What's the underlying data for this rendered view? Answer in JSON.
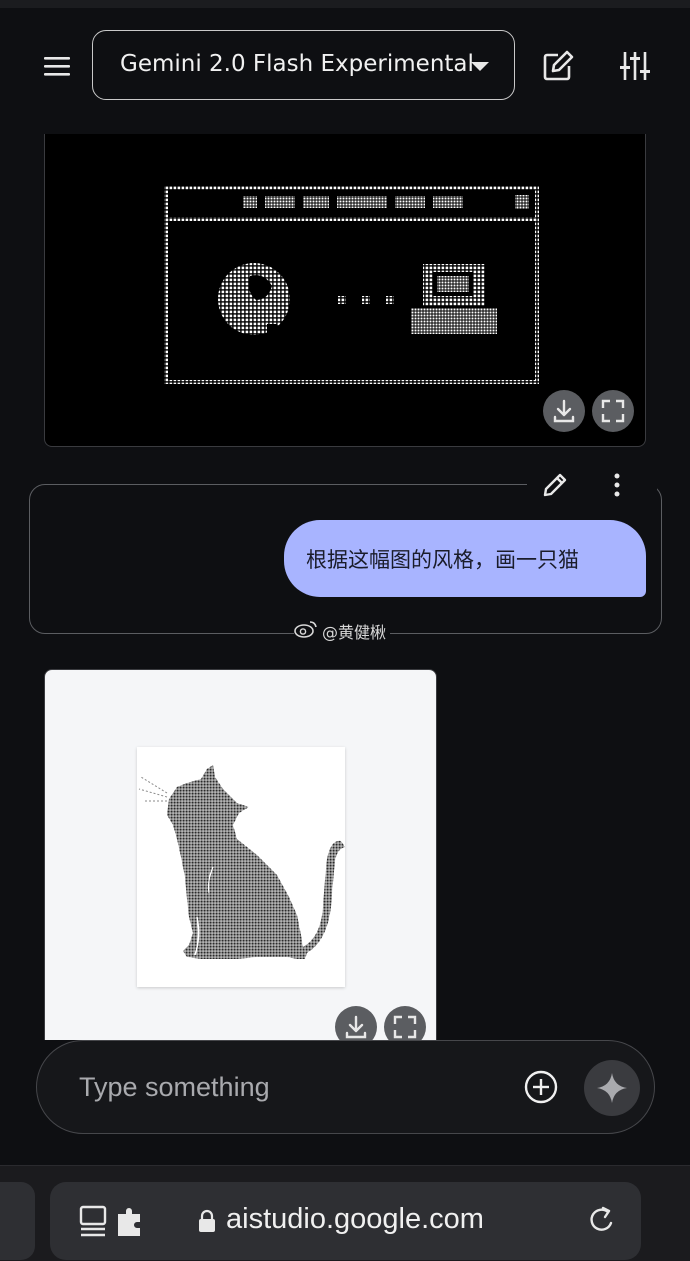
{
  "header": {
    "menu_icon": "hamburger-menu-icon",
    "model_name": "Gemini 2.0 Flash Experimental",
    "new_chat_icon": "edit-square-icon",
    "settings_icon": "tune-sliders-icon"
  },
  "messages": [
    {
      "role": "model",
      "type": "image",
      "description": "pixel-art retro window with globe and computer",
      "actions": [
        "download-icon",
        "fullscreen-icon"
      ]
    },
    {
      "role": "user",
      "text": "根据这幅图的风格，画一只猫",
      "actions": [
        "edit-pencil-icon",
        "more-vert-icon"
      ]
    },
    {
      "role": "model",
      "type": "image",
      "description": "pixel-art dotted cat silhouette",
      "actions": [
        "download-icon",
        "fullscreen-icon"
      ]
    }
  ],
  "watermark": {
    "icon": "weibo-icon",
    "text": "@黄健楸"
  },
  "composer": {
    "placeholder": "Type something",
    "add_icon": "add-circle-icon",
    "send_icon": "sparkle-icon"
  },
  "browser": {
    "url": "aistudio.google.com",
    "tabs_icon": "tabs-icon",
    "lock_icon": "lock-icon",
    "reload_icon": "reload-icon"
  },
  "colors": {
    "background": "#0e0f12",
    "user_bubble": "#a8b4ff",
    "border": "#5b5d61"
  }
}
